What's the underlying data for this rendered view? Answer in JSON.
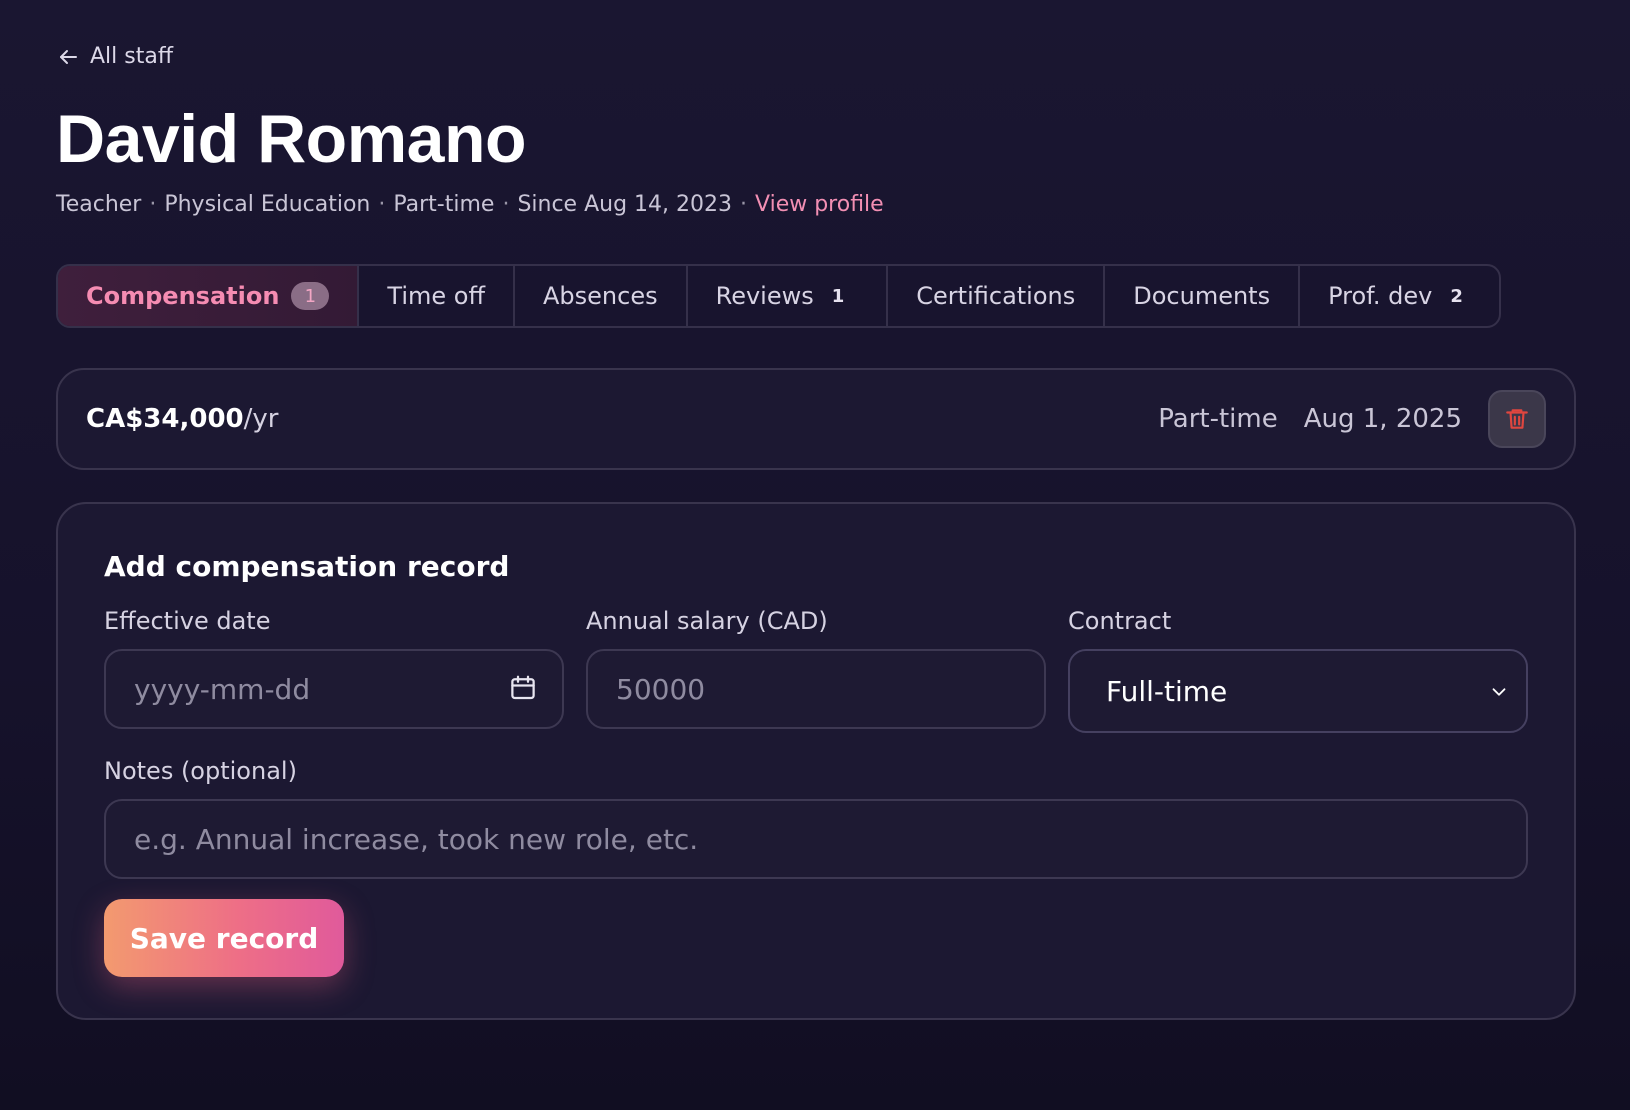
{
  "nav": {
    "back_label": "All staff"
  },
  "header": {
    "name": "David Romano",
    "role": "Teacher",
    "department": "Physical Education",
    "employment": "Part-time",
    "since": "Since Aug 14, 2023",
    "separator": "·",
    "profile_link": "View profile"
  },
  "tabs": [
    {
      "label": "Compensation",
      "badge": "1",
      "active": true
    },
    {
      "label": "Time off",
      "badge": ""
    },
    {
      "label": "Absences",
      "badge": ""
    },
    {
      "label": "Reviews",
      "badge": "1"
    },
    {
      "label": "Certifications",
      "badge": ""
    },
    {
      "label": "Documents",
      "badge": ""
    },
    {
      "label": "Prof. dev",
      "badge": "2"
    }
  ],
  "record": {
    "amount": "CA$34,000",
    "period": "/yr",
    "contract": "Part-time",
    "date": "Aug 1, 2025"
  },
  "form": {
    "title": "Add compensation record",
    "effective_date_label": "Effective date",
    "effective_date_placeholder": "yyyy-mm-dd",
    "salary_label": "Annual salary (CAD)",
    "salary_placeholder": "50000",
    "contract_label": "Contract",
    "contract_value": "Full-time",
    "notes_label": "Notes (optional)",
    "notes_placeholder": "e.g. Annual increase, took new role, etc.",
    "save_label": "Save record"
  },
  "colors": {
    "accent": "#f28fb3",
    "trash": "#e0463f",
    "button_start": "#f39a6f",
    "button_end": "#e05a9b"
  }
}
